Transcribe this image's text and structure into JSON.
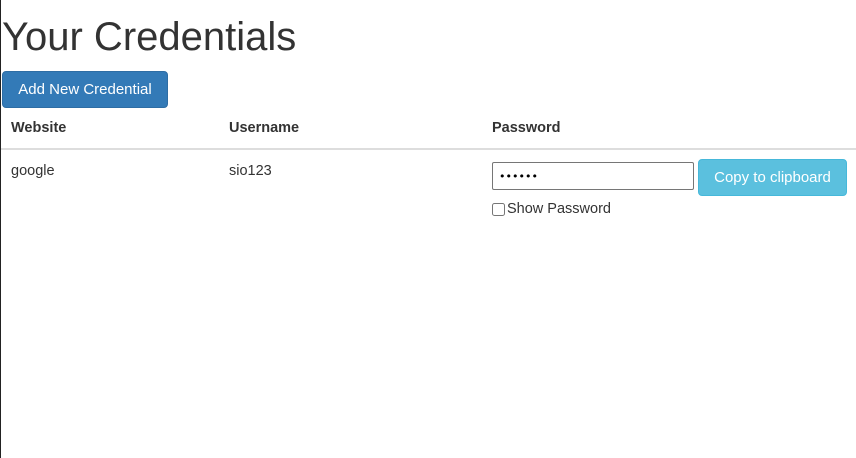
{
  "page": {
    "title": "Your Credentials"
  },
  "actions": {
    "add_label": "Add New Credential"
  },
  "table": {
    "headers": {
      "website": "Website",
      "username": "Username",
      "password": "Password"
    },
    "rows": [
      {
        "website": "google",
        "username": "sio123",
        "password_masked": "••••••",
        "copy_label": "Copy to clipboard",
        "show_password_label": "Show Password",
        "show_password_checked": false
      }
    ]
  },
  "colors": {
    "primary": "#337ab7",
    "info": "#5bc0de"
  }
}
